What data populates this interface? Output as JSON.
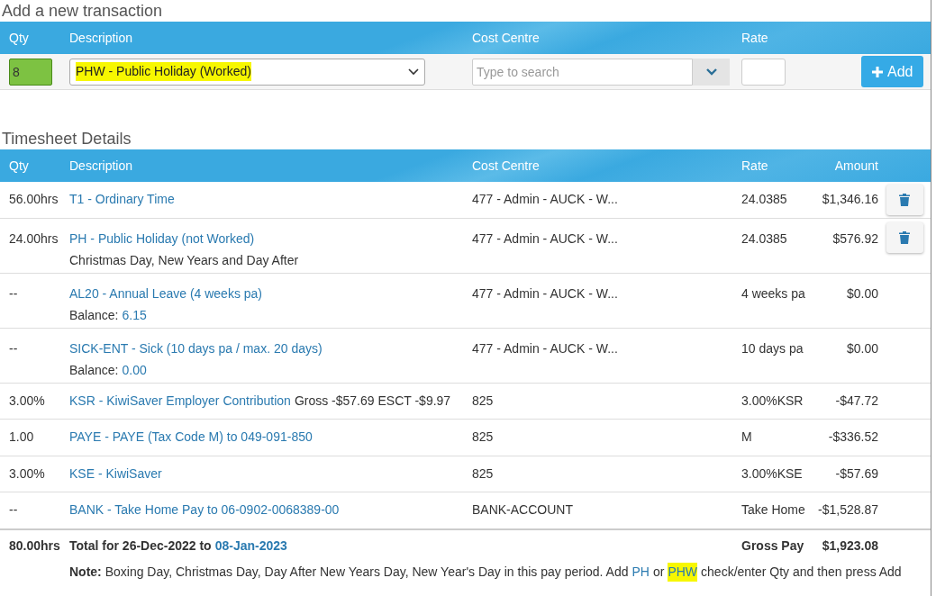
{
  "add_section": {
    "title": "Add a new transaction",
    "columns": [
      "Qty",
      "Description",
      "Cost Centre",
      "Rate"
    ],
    "qty": {
      "value": "8",
      "valid": true
    },
    "description": {
      "value": "PHW - Public Holiday (Worked)",
      "highlighted": true
    },
    "cost_centre": {
      "placeholder": "Type to search"
    },
    "add_button": "Add"
  },
  "timesheet": {
    "title": "Timesheet Details",
    "columns": [
      "Qty",
      "Description",
      "Cost Centre",
      "Rate",
      "Amount"
    ],
    "rows": [
      {
        "qty": "56.00hrs",
        "description": "T1 - Ordinary Time",
        "cost_centre": "477 - Admin - AUCK - W...",
        "rate": "24.0385",
        "amount": "$1,346.16",
        "deletable": true
      },
      {
        "qty": "24.00hrs",
        "description": "PH - Public Holiday (not Worked)",
        "subtext": "Christmas Day, New Years and Day After",
        "cost_centre": "477 - Admin - AUCK - W...",
        "rate": "24.0385",
        "amount": "$576.92",
        "deletable": true
      },
      {
        "qty": "--",
        "description": "AL20 - Annual Leave (4 weeks pa)",
        "balance_label": "Balance:",
        "balance": "6.15",
        "cost_centre": "477 - Admin - AUCK - W...",
        "rate": "4 weeks pa",
        "amount": "$0.00",
        "deletable": false
      },
      {
        "qty": "--",
        "description": "SICK-ENT - Sick (10 days pa / max. 20 days)",
        "balance_label": "Balance:",
        "balance": "0.00",
        "cost_centre": "477 - Admin - AUCK - W...",
        "rate": "10 days pa",
        "amount": "$0.00",
        "deletable": false
      },
      {
        "qty": "3.00%",
        "description": "KSR - KiwiSaver Employer Contribution",
        "extra": "Gross -$57.69 ESCT -$9.97",
        "cost_centre": "825",
        "rate": "3.00%KSR",
        "amount": "-$47.72",
        "deletable": false
      },
      {
        "qty": "1.00",
        "description": "PAYE - PAYE (Tax Code M) to 049-091-850",
        "cost_centre": "825",
        "rate": "M",
        "amount": "-$336.52",
        "deletable": false
      },
      {
        "qty": "3.00%",
        "description": "KSE - KiwiSaver",
        "cost_centre": "825",
        "rate": "3.00%KSE",
        "amount": "-$57.69",
        "deletable": false
      },
      {
        "qty": "--",
        "description": "BANK - Take Home Pay to 06-0902-0068389-00",
        "cost_centre": "BANK-ACCOUNT",
        "rate": "Take Home",
        "amount": "-$1,528.87",
        "deletable": false
      }
    ],
    "total": {
      "qty": "80.00hrs",
      "label": "Total for 26-Dec-2022 to",
      "end_date": "08-Jan-2023",
      "gross_label": "Gross Pay",
      "gross": "$1,923.08"
    },
    "note": [
      {
        "kind": "text",
        "text": "**Note:** Boxing Day, Christmas Day, Day After New Years Day, New Year's Day in this pay period. Add"
      },
      {
        "kind": "link",
        "text": "PH",
        "highlighted": false
      },
      {
        "kind": "text",
        "text": "or"
      },
      {
        "kind": "link",
        "text": "PHW",
        "highlighted": true
      },
      {
        "kind": "text",
        "text": "check/enter Qty and then press Add"
      }
    ]
  }
}
